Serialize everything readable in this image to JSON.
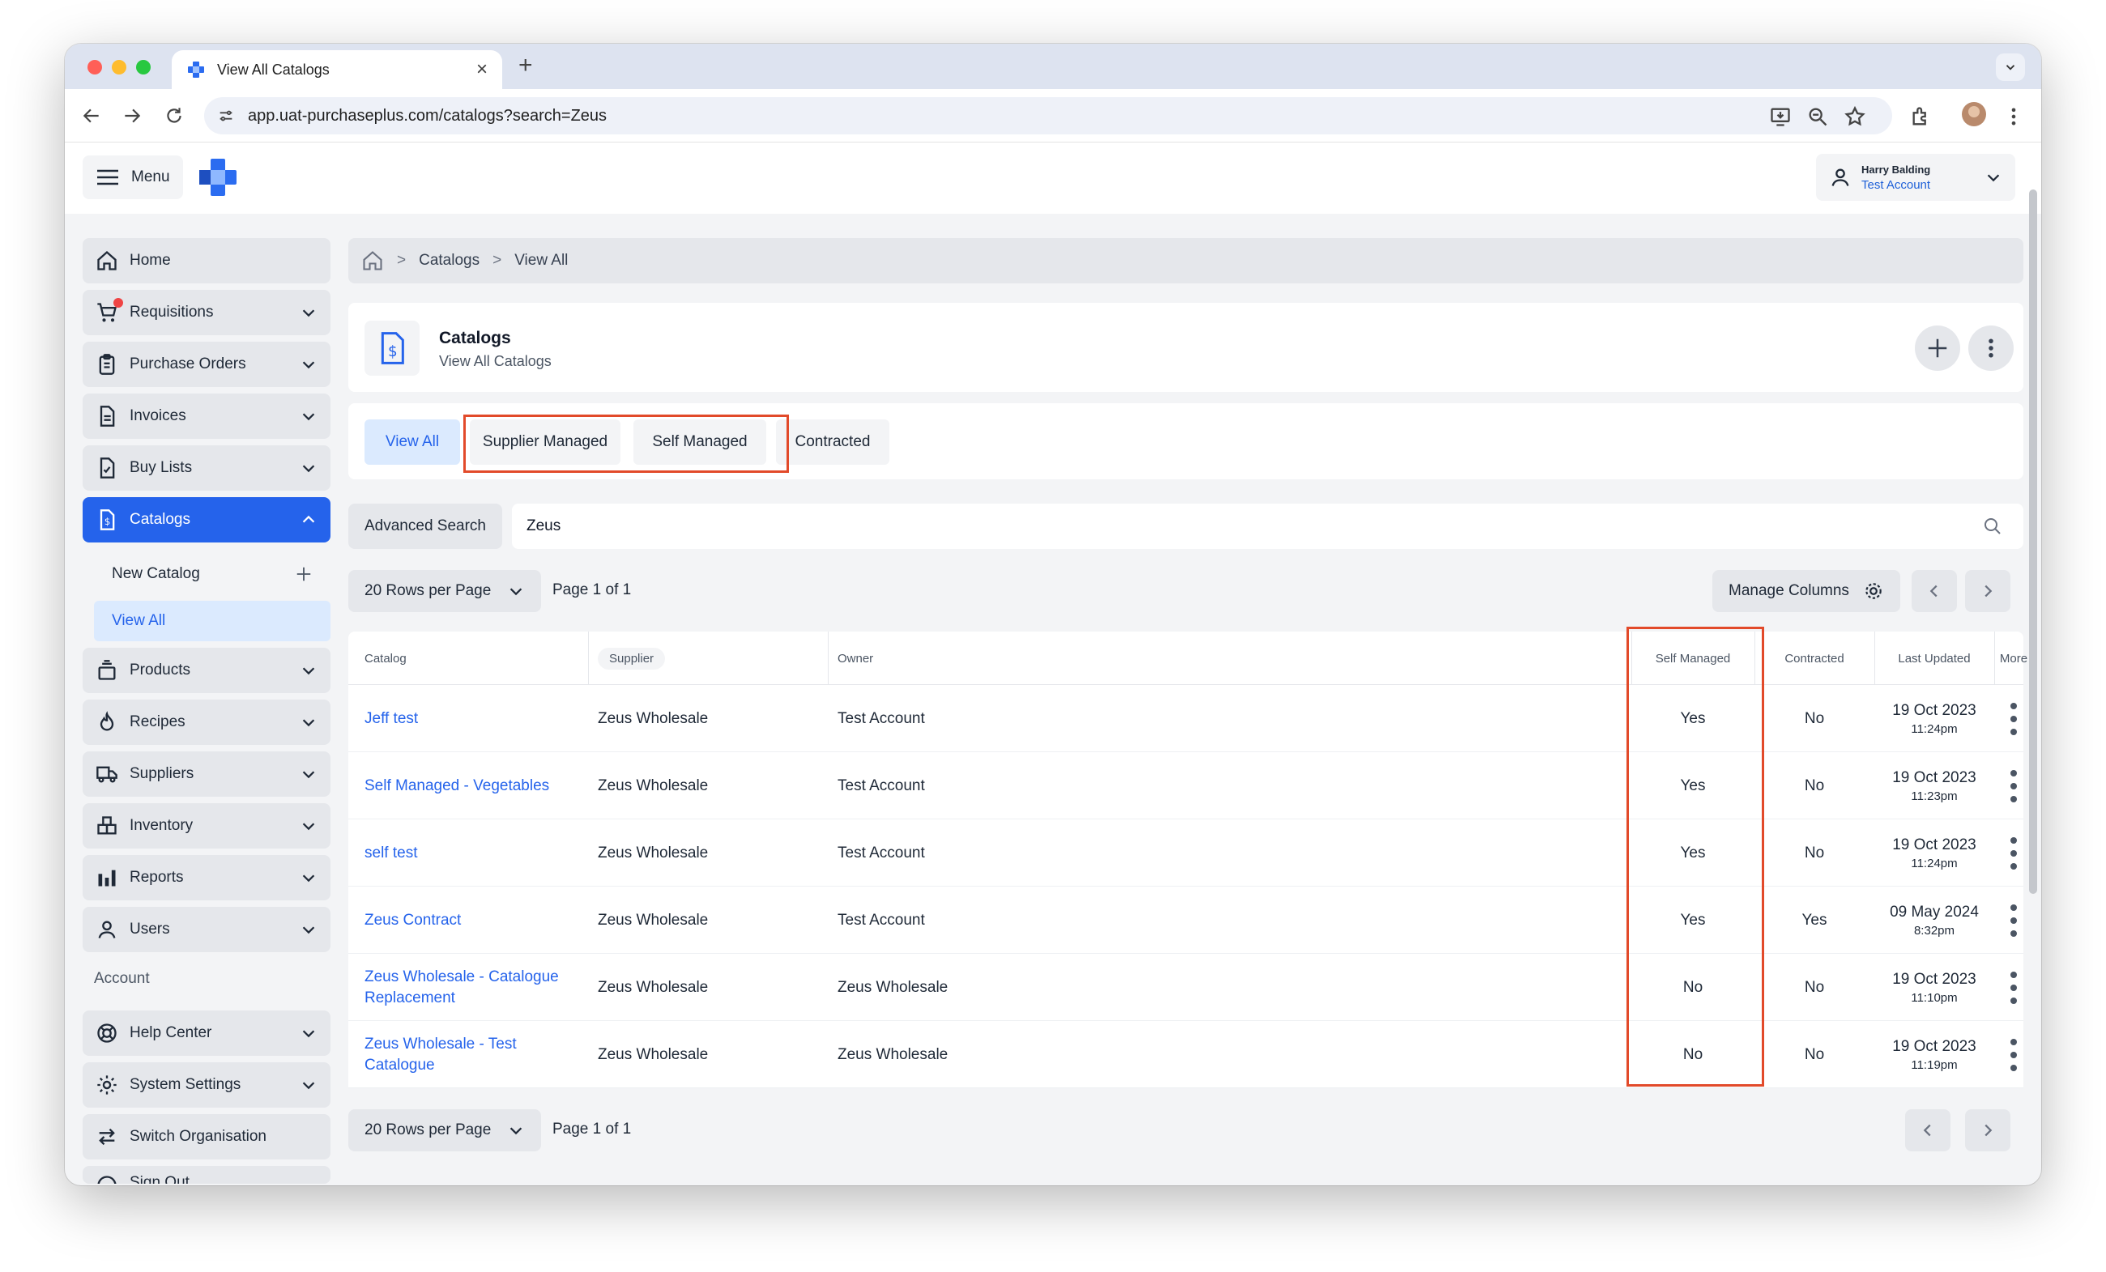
{
  "browser": {
    "tab_title": "View All Catalogs",
    "url": "app.uat-purchaseplus.com/catalogs?search=Zeus"
  },
  "header": {
    "menu_label": "Menu",
    "user_name": "Harry Balding",
    "user_org": "Test Account"
  },
  "sidebar": {
    "items": [
      {
        "label": "Home",
        "icon": "home-icon"
      },
      {
        "label": "Requisitions",
        "icon": "cart-icon"
      },
      {
        "label": "Purchase Orders",
        "icon": "clipboard-icon"
      },
      {
        "label": "Invoices",
        "icon": "document-icon"
      },
      {
        "label": "Buy Lists",
        "icon": "checklist-icon"
      },
      {
        "label": "Catalogs",
        "icon": "catalog-dollar-icon"
      }
    ],
    "catalog_sub": {
      "new_catalog": "New Catalog",
      "view_all": "View All"
    },
    "items2": [
      {
        "label": "Products",
        "icon": "products-icon"
      },
      {
        "label": "Recipes",
        "icon": "flame-icon"
      },
      {
        "label": "Suppliers",
        "icon": "truck-icon"
      },
      {
        "label": "Inventory",
        "icon": "inventory-icon"
      },
      {
        "label": "Reports",
        "icon": "bar-chart-icon"
      },
      {
        "label": "Users",
        "icon": "user-icon"
      }
    ],
    "account_label": "Account",
    "account_items": [
      {
        "label": "Help Center",
        "icon": "lifebuoy-icon"
      },
      {
        "label": "System Settings",
        "icon": "gear-icon"
      },
      {
        "label": "Switch Organisation",
        "icon": "switch-arrows-icon"
      },
      {
        "label": "Sign Out",
        "icon": "sign-out-icon"
      }
    ]
  },
  "breadcrumb": {
    "items": [
      "Catalogs",
      "View All"
    ]
  },
  "page": {
    "title": "Catalogs",
    "subtitle": "View All Catalogs"
  },
  "filter_tabs": [
    "View All",
    "Supplier Managed",
    "Self Managed",
    "Contracted"
  ],
  "search": {
    "advanced_label": "Advanced Search",
    "value": "Zeus"
  },
  "pagination": {
    "rows_label": "20 Rows per Page",
    "page_info": "Page 1 of 1",
    "manage_columns": "Manage Columns"
  },
  "table": {
    "headers": [
      "Catalog",
      "Supplier",
      "Owner",
      "Self Managed",
      "Contracted",
      "Last Updated",
      "More"
    ],
    "rows": [
      {
        "catalog": "Jeff test",
        "supplier": "Zeus Wholesale",
        "owner": "Test Account",
        "self_managed": "Yes",
        "contracted": "No",
        "date": "19 Oct 2023",
        "time": "11:24pm"
      },
      {
        "catalog": "Self Managed - Vegetables",
        "supplier": "Zeus Wholesale",
        "owner": "Test Account",
        "self_managed": "Yes",
        "contracted": "No",
        "date": "19 Oct 2023",
        "time": "11:23pm"
      },
      {
        "catalog": "self test",
        "supplier": "Zeus Wholesale",
        "owner": "Test Account",
        "self_managed": "Yes",
        "contracted": "No",
        "date": "19 Oct 2023",
        "time": "11:24pm"
      },
      {
        "catalog": "Zeus Contract",
        "supplier": "Zeus Wholesale",
        "owner": "Test Account",
        "self_managed": "Yes",
        "contracted": "Yes",
        "date": "09 May 2024",
        "time": "8:32pm"
      },
      {
        "catalog": "Zeus Wholesale - Catalogue Replacement",
        "supplier": "Zeus Wholesale",
        "owner": "Zeus Wholesale",
        "self_managed": "No",
        "contracted": "No",
        "date": "19 Oct 2023",
        "time": "11:10pm"
      },
      {
        "catalog": "Zeus Wholesale - Test Catalogue",
        "supplier": "Zeus Wholesale",
        "owner": "Zeus Wholesale",
        "self_managed": "No",
        "contracted": "No",
        "date": "19 Oct 2023",
        "time": "11:19pm"
      }
    ]
  },
  "colors": {
    "accent": "#2563eb",
    "highlight": "#e24a2a",
    "badge": "#ef4444"
  }
}
